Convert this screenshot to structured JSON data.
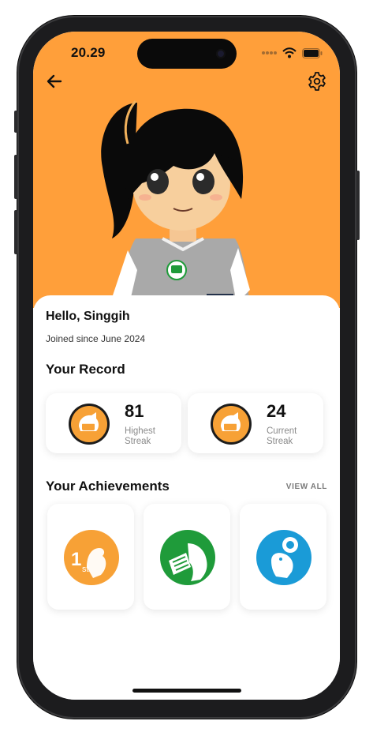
{
  "status": {
    "time": "20.29"
  },
  "nav": {
    "back_icon": "arrow-left-icon",
    "settings_icon": "gear-icon"
  },
  "colors": {
    "hero_bg": "#ff9f3a",
    "medal_orange": "#f7a136",
    "badge_green": "#1f9b3a",
    "badge_blue": "#1a9bd7"
  },
  "profile": {
    "greeting": "Hello, Singgih",
    "joined": "Joined since June 2024"
  },
  "record": {
    "title": "Your Record",
    "items": [
      {
        "value": "81",
        "label_line1": "Highest",
        "label_line2": "Streak"
      },
      {
        "value": "24",
        "label_line1": "Current",
        "label_line2": "Streak"
      }
    ]
  },
  "achievements": {
    "title": "Your Achievements",
    "view_all": "VIEW ALL",
    "badges": [
      {
        "icon": "first-place-badge-icon",
        "text": "1",
        "suffix": "st"
      },
      {
        "icon": "study-badge-icon"
      },
      {
        "icon": "explorer-badge-icon"
      }
    ]
  }
}
